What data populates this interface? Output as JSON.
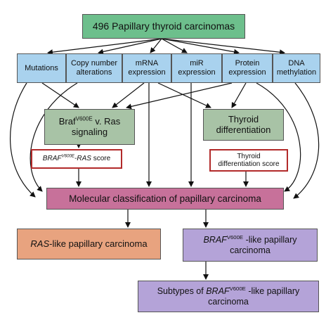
{
  "top": {
    "label": "496 Papillary thyroid carcinomas"
  },
  "platforms": [
    {
      "line1": "Mutations",
      "line2": ""
    },
    {
      "line1": "Copy number",
      "line2": "alterations"
    },
    {
      "line1": "mRNA",
      "line2": "expression"
    },
    {
      "line1": "miR",
      "line2": "expression"
    },
    {
      "line1": "Protein",
      "line2": "expression"
    },
    {
      "line1": "DNA",
      "line2": "methylation"
    }
  ],
  "signaling": {
    "a": "Braf",
    "sup": "V600E",
    "b": " v. Ras",
    "line2": "signaling"
  },
  "differentiation": {
    "line1": "Thyroid",
    "line2": "differentiation"
  },
  "brs_score": {
    "a": "BRAF",
    "sup": "V600E",
    "b": "-RAS",
    "c": " score"
  },
  "tds_score": {
    "line1": "Thyroid",
    "line2": "differentiation score"
  },
  "classification": {
    "label": "Molecular classification of papillary carcinoma"
  },
  "ras_like": {
    "a": "RAS",
    "b": "-like papillary carcinoma"
  },
  "braf_like": {
    "a": "BRAF",
    "sup": "V600E",
    "b": " -like papillary",
    "line2": "carcinoma"
  },
  "subtypes": {
    "a": "Subtypes of ",
    "b": "BRAF",
    "sup": "V600E",
    "c": " -like papillary",
    "line2": "carcinoma"
  },
  "colors": {
    "top": "#6dbf8c",
    "platform": "#a9d2ee",
    "intermediate": "#a8c3a6",
    "score_border": "#b22a2a",
    "classification": "#c7719a",
    "ras_like": "#e8a37f",
    "braf_like": "#b4a3d8"
  }
}
